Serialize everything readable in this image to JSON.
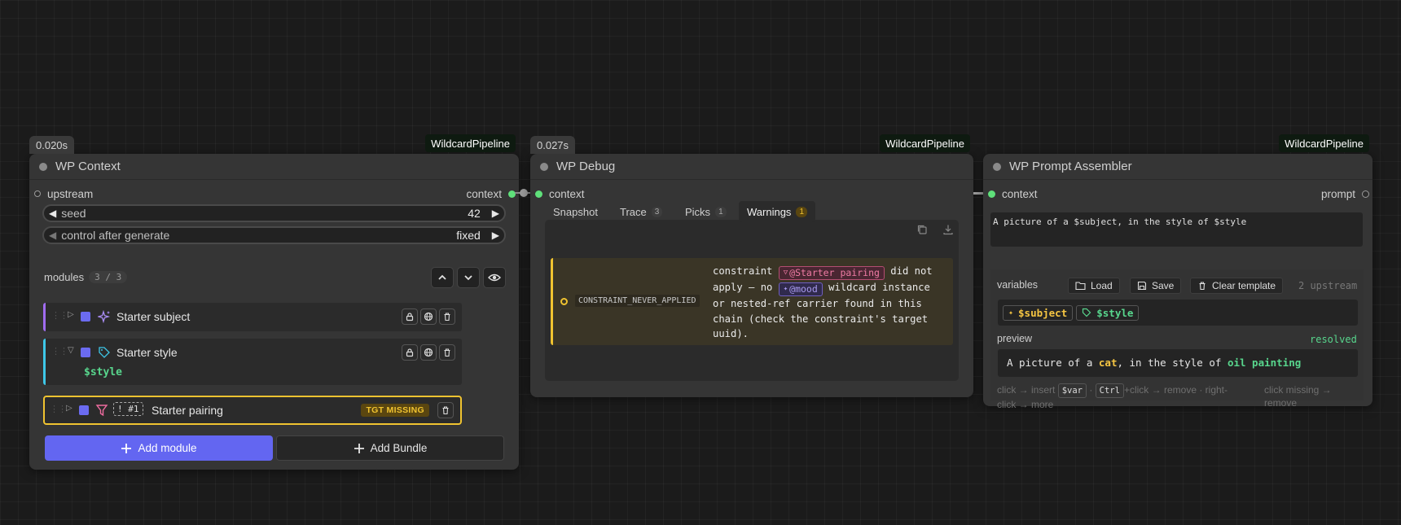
{
  "nodes": {
    "context": {
      "exec_time": "0.020s",
      "pipeline": "WildcardPipeline",
      "title": "WP Context",
      "input_label": "upstream",
      "output_label": "context",
      "seed_label": "seed",
      "seed_value": "42",
      "control_label": "control after generate",
      "control_value": "fixed",
      "modules_label": "modules",
      "modules_count": "3 / 3",
      "modules": [
        {
          "name": "Starter subject",
          "accent": "#a06cf0"
        },
        {
          "name": "Starter style",
          "accent": "#3ec7e8",
          "value": "$style"
        },
        {
          "name": "Starter pairing",
          "accent": "#f0c330",
          "ref": "! #1",
          "badge": "TGT MISSING"
        }
      ],
      "add_module_label": "Add module",
      "add_bundle_label": "Add Bundle"
    },
    "debug": {
      "exec_time": "0.027s",
      "pipeline": "WildcardPipeline",
      "title": "WP Debug",
      "input_label": "context",
      "tabs": [
        {
          "label": "Snapshot"
        },
        {
          "label": "Trace",
          "count": "3"
        },
        {
          "label": "Picks",
          "count": "1"
        },
        {
          "label": "Warnings",
          "count": "1",
          "active": true
        }
      ],
      "warning": {
        "code": "CONSTRAINT_NEVER_APPLIED",
        "t1": "constraint",
        "chip1": "@Starter pairing",
        "t2": "did not",
        "t3": "apply — no",
        "chip2": "@mood",
        "t4": "wildcard instance",
        "t5": "or nested-ref carrier found in this",
        "t6": "chain (check the constraint's target",
        "t7": "uuid)."
      }
    },
    "assembler": {
      "pipeline": "WildcardPipeline",
      "title": "WP Prompt Assembler",
      "input_label": "context",
      "output_label": "prompt",
      "template": "A picture of a $subject, in the style of $style",
      "variables_label": "variables",
      "load_label": "Load",
      "save_label": "Save",
      "clear_label": "Clear template",
      "upstream_count": "2 upstream",
      "vars": [
        "$subject",
        "$style"
      ],
      "preview_label": "preview",
      "preview_status": "resolved",
      "preview_pre1": "A picture of a ",
      "preview_v1": "cat",
      "preview_mid": ", in the style of ",
      "preview_v2": "oil painting",
      "help_left_1": "click → insert",
      "help_kbd1": "$var",
      "help_sep": "·",
      "help_kbd2": "Ctrl",
      "help_left_2": "+click → remove · right-",
      "help_left_3": "click → more",
      "help_right_1": "click missing →",
      "help_right_2": "remove"
    }
  },
  "colors": {
    "accent": "#6366f1",
    "slot_green": "#5fe07a",
    "warning": "#f0c330",
    "var_yellow": "#f5c542",
    "var_green": "#58d68d"
  }
}
